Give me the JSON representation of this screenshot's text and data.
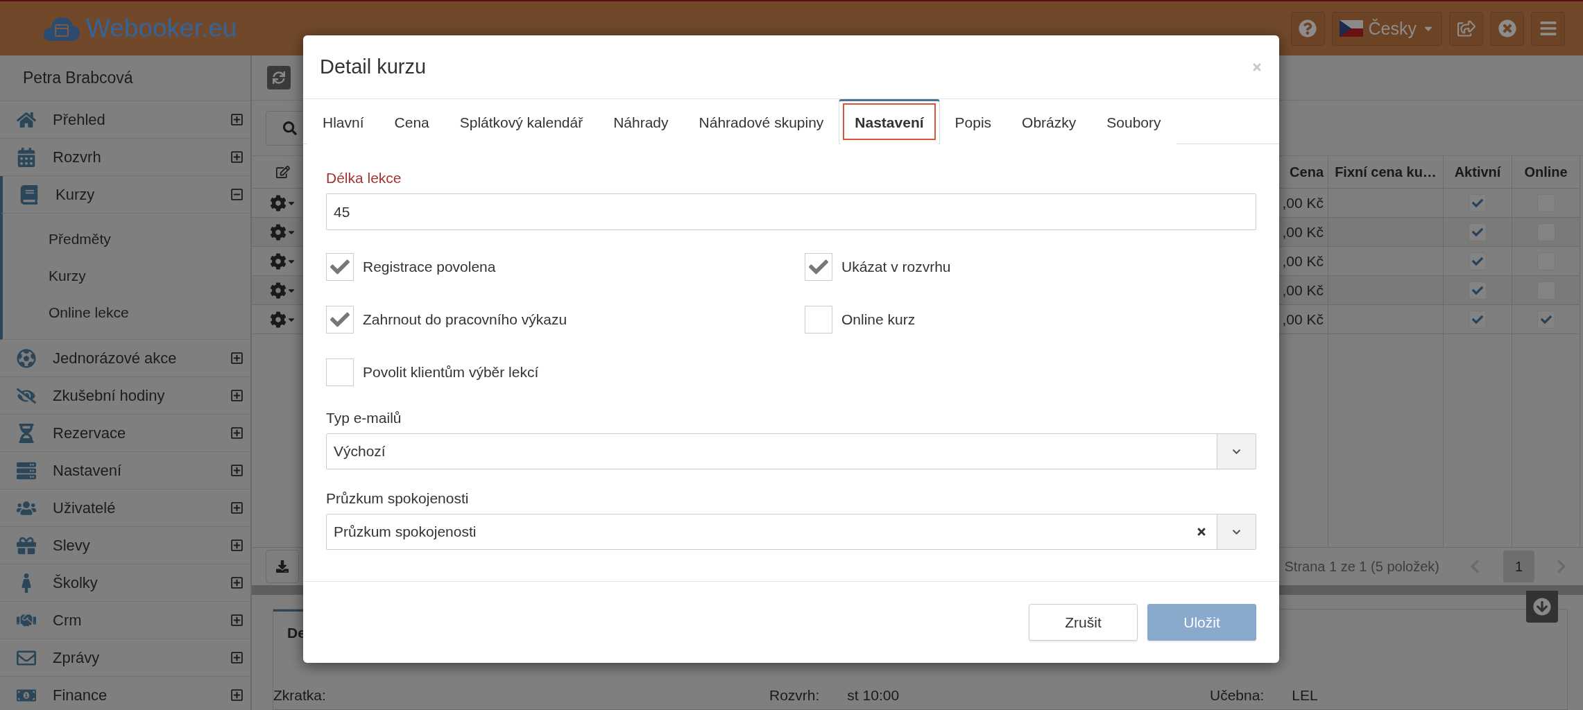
{
  "header": {
    "logo": "Webooker.eu",
    "language": "Česky"
  },
  "sidebar": {
    "user": "Petra Brabcová",
    "items": [
      {
        "label": "Přehled",
        "expanded": false
      },
      {
        "label": "Rozvrh",
        "expanded": false
      },
      {
        "label": "Kurzy",
        "expanded": true,
        "children": [
          {
            "label": "Předměty"
          },
          {
            "label": "Kurzy"
          },
          {
            "label": "Online lekce"
          }
        ]
      },
      {
        "label": "Jednorázové akce",
        "expanded": false
      },
      {
        "label": "Zkušební hodiny",
        "expanded": false
      },
      {
        "label": "Rezervace",
        "expanded": false
      },
      {
        "label": "Nastavení",
        "expanded": false
      },
      {
        "label": "Uživatelé",
        "expanded": false
      },
      {
        "label": "Slevy",
        "expanded": false
      },
      {
        "label": "Školky",
        "expanded": false
      },
      {
        "label": "Crm",
        "expanded": false
      },
      {
        "label": "Zprávy",
        "expanded": false
      },
      {
        "label": "Finance",
        "expanded": false
      }
    ]
  },
  "table": {
    "columns": [
      "Cena",
      "Fixní cena ku…",
      "Aktivní",
      "Online"
    ],
    "rows": [
      {
        "price": ",00 Kč",
        "active": true,
        "online": false
      },
      {
        "price": ",00 Kč",
        "active": true,
        "online": false
      },
      {
        "price": ",00 Kč",
        "active": true,
        "online": false
      },
      {
        "price": ",00 Kč",
        "active": true,
        "online": false
      },
      {
        "price": ",00 Kč",
        "active": true,
        "online": true
      }
    ]
  },
  "pager": {
    "summary": "Strana 1 ze 1 (5 položek)",
    "pages": [
      {
        "label": "1",
        "selected": true
      }
    ]
  },
  "detail_panel": {
    "tab": "De",
    "fields": [
      {
        "label": "Zkratka:"
      },
      {
        "label": "Rozvrh:",
        "value": "st 10:00"
      },
      {
        "label": "Učebna:",
        "value": "LEL"
      }
    ]
  },
  "modal": {
    "title": "Detail kurzu",
    "tabs": [
      {
        "label": "Hlavní",
        "selected": false
      },
      {
        "label": "Cena",
        "selected": false
      },
      {
        "label": "Splátkový kalendář",
        "selected": false
      },
      {
        "label": "Náhrady",
        "selected": false
      },
      {
        "label": "Náhradové skupiny",
        "selected": false
      },
      {
        "label": "Nastavení",
        "selected": true
      },
      {
        "label": "Popis",
        "selected": false
      },
      {
        "label": "Obrázky",
        "selected": false
      },
      {
        "label": "Soubory",
        "selected": false
      }
    ],
    "lesson_length": {
      "label": "Délka lekce",
      "value": "45"
    },
    "checkboxes": [
      {
        "label": "Registrace povolena",
        "checked": true
      },
      {
        "label": "Ukázat v rozvrhu",
        "checked": true
      },
      {
        "label": "Zahrnout do pracovního výkazu",
        "checked": true
      },
      {
        "label": "Online kurz",
        "checked": false
      },
      {
        "label": "Povolit klientům výběr lekcí",
        "checked": false
      }
    ],
    "selects": [
      {
        "label": "Typ e-mailů",
        "value": "Výchozí",
        "clearable": false
      },
      {
        "label": "Průzkum spokojenosti",
        "value": "Průzkum spokojenosti",
        "clearable": true
      }
    ],
    "buttons": [
      {
        "label": "Zrušit",
        "kind": "secondary"
      },
      {
        "label": "Uložit",
        "kind": "primary"
      }
    ]
  }
}
